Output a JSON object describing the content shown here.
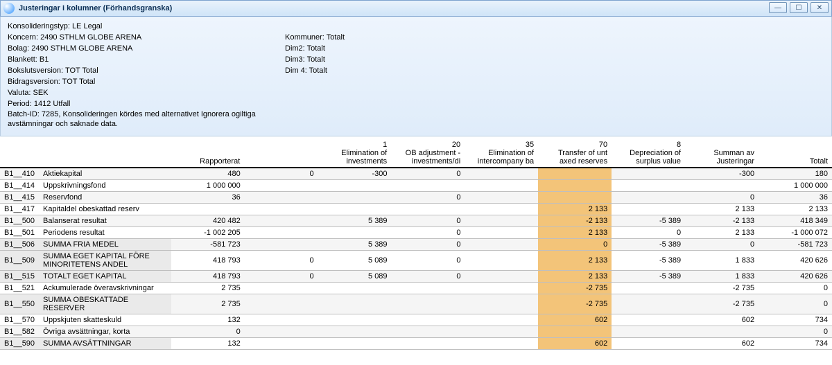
{
  "window": {
    "title": "Justeringar i kolumner (Förhandsgranska)"
  },
  "header": {
    "konsolideringstyp": "Konsolideringstyp: LE Legal",
    "koncern": "Koncern: 2490  STHLM GLOBE ARENA",
    "bolag": "Bolag: 2490  STHLM GLOBE ARENA",
    "blankett": "Blankett: B1",
    "bokslutsversion": "Bokslutsversion: TOT Total",
    "bidragsversion": "Bidragsversion: TOT Total",
    "valuta": "Valuta: SEK",
    "period": "Period: 1412 Utfall",
    "batch": "Batch-ID: 7285, Konsolideringen kördes med alternativet Ignorera ogiltiga avstämningar och saknade data.",
    "kommuner": "Kommuner: Totalt",
    "dim2": "Dim2: Totalt",
    "dim3": "Dim3: Totalt",
    "dim4": "Dim 4: Totalt"
  },
  "columns": {
    "rapporterat": "Rapporterat",
    "c1_num": "1",
    "c1_lbl": "Elimination of investments",
    "c2_num": "20",
    "c2_lbl": "OB adjustment - investments/di",
    "c3_num": "35",
    "c3_lbl": "Elimination of intercompany ba",
    "c4_num": "70",
    "c4_lbl": "Transfer of unt axed reserves",
    "c5_num": "8",
    "c5_lbl": "Depreciation of surplus value",
    "summa": "Summan av Justeringar",
    "totalt": "Totalt",
    "blank": ""
  },
  "rows": [
    {
      "code": "B1__410",
      "desc": "Aktiekapital",
      "v": [
        "480",
        "0",
        "-300",
        "0",
        "",
        "",
        "",
        "-300",
        "180"
      ]
    },
    {
      "code": "B1__414",
      "desc": "Uppskrivningsfond",
      "v": [
        "1 000 000",
        "",
        "",
        "",
        "",
        "",
        "",
        "",
        "1 000 000"
      ]
    },
    {
      "code": "B1__415",
      "desc": "Reservfond",
      "v": [
        "36",
        "",
        "",
        "0",
        "",
        "",
        "",
        "0",
        "36"
      ]
    },
    {
      "code": "B1__417",
      "desc": "Kapitaldel obeskattad reserv",
      "v": [
        "",
        "",
        "",
        "",
        "",
        "2 133",
        "",
        "2 133",
        "2 133"
      ]
    },
    {
      "code": "B1__500",
      "desc": "Balanserat resultat",
      "v": [
        "420 482",
        "",
        "5 389",
        "0",
        "",
        "-2 133",
        "-5 389",
        "-2 133",
        "418 349"
      ]
    },
    {
      "code": "B1__501",
      "desc": "Periodens resultat",
      "v": [
        "-1 002 205",
        "",
        "",
        "0",
        "",
        "2 133",
        "0",
        "2 133",
        "-1 000 072"
      ]
    },
    {
      "code": "B1__506",
      "desc": "SUMMA FRIA MEDEL",
      "v": [
        "-581 723",
        "",
        "5 389",
        "0",
        "",
        "0",
        "-5 389",
        "0",
        "-581 723"
      ],
      "summa": true
    },
    {
      "code": "B1__509",
      "desc": "SUMMA EGET KAPITAL FÖRE MINORITETENS ANDEL",
      "v": [
        "418 793",
        "0",
        "5 089",
        "0",
        "",
        "2 133",
        "-5 389",
        "1 833",
        "420 626"
      ],
      "summa": true
    },
    {
      "code": "B1__515",
      "desc": "TOTALT EGET KAPITAL",
      "v": [
        "418 793",
        "0",
        "5 089",
        "0",
        "",
        "2 133",
        "-5 389",
        "1 833",
        "420 626"
      ],
      "summa": true
    },
    {
      "code": "B1__521",
      "desc": "Ackumulerade överavskrivningar",
      "v": [
        "2 735",
        "",
        "",
        "",
        "",
        "-2 735",
        "",
        "-2 735",
        "0"
      ]
    },
    {
      "code": "B1__550",
      "desc": "SUMMA OBESKATTADE RESERVER",
      "v": [
        "2 735",
        "",
        "",
        "",
        "",
        "-2 735",
        "",
        "-2 735",
        "0"
      ],
      "summa": true
    },
    {
      "code": "B1__570",
      "desc": "Uppskjuten skatteskuld",
      "v": [
        "132",
        "",
        "",
        "",
        "",
        "602",
        "",
        "602",
        "734"
      ]
    },
    {
      "code": "B1__582",
      "desc": "Övriga avsättningar, korta",
      "v": [
        "0",
        "",
        "",
        "",
        "",
        "",
        "",
        "",
        "0"
      ]
    },
    {
      "code": "B1__590",
      "desc": "SUMMA AVSÄTTNINGAR",
      "v": [
        "132",
        "",
        "",
        "",
        "",
        "602",
        "",
        "602",
        "734"
      ],
      "summa": true
    }
  ]
}
